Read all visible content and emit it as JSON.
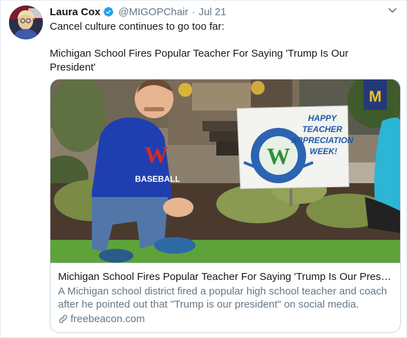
{
  "tweet": {
    "author_name": "Laura Cox",
    "handle": "@MIGOPChair",
    "separator": "·",
    "date": "Jul 21",
    "text_line1": "Cancel culture continues to go too far:",
    "text_line2": "Michigan School Fires Popular Teacher For Saying 'Trump Is Our President'"
  },
  "card": {
    "title": "Michigan School Fires Popular Teacher For Saying 'Trump Is Our President'",
    "description": "A Michigan school district fired a popular high school teacher and coach after he pointed out that \"Trump is our president\" on social media.",
    "domain": "freebeacon.com",
    "image": {
      "hoodie_letter": "W",
      "hoodie_text": "BASEBALL",
      "sign_lines": [
        "HAPPY",
        "TEACHER",
        "APPRECIATION",
        "WEEK!"
      ],
      "sign_logo_letter": "W",
      "flag_letter": "M"
    }
  },
  "icons": {
    "verified": "verified-badge-icon",
    "chevron": "chevron-down-icon",
    "link": "link-icon"
  },
  "colors": {
    "verified_blue": "#1da1f2",
    "secondary_text": "#657786",
    "hoodie_blue": "#1f3fb0",
    "hoodie_red": "#d62a2a"
  }
}
